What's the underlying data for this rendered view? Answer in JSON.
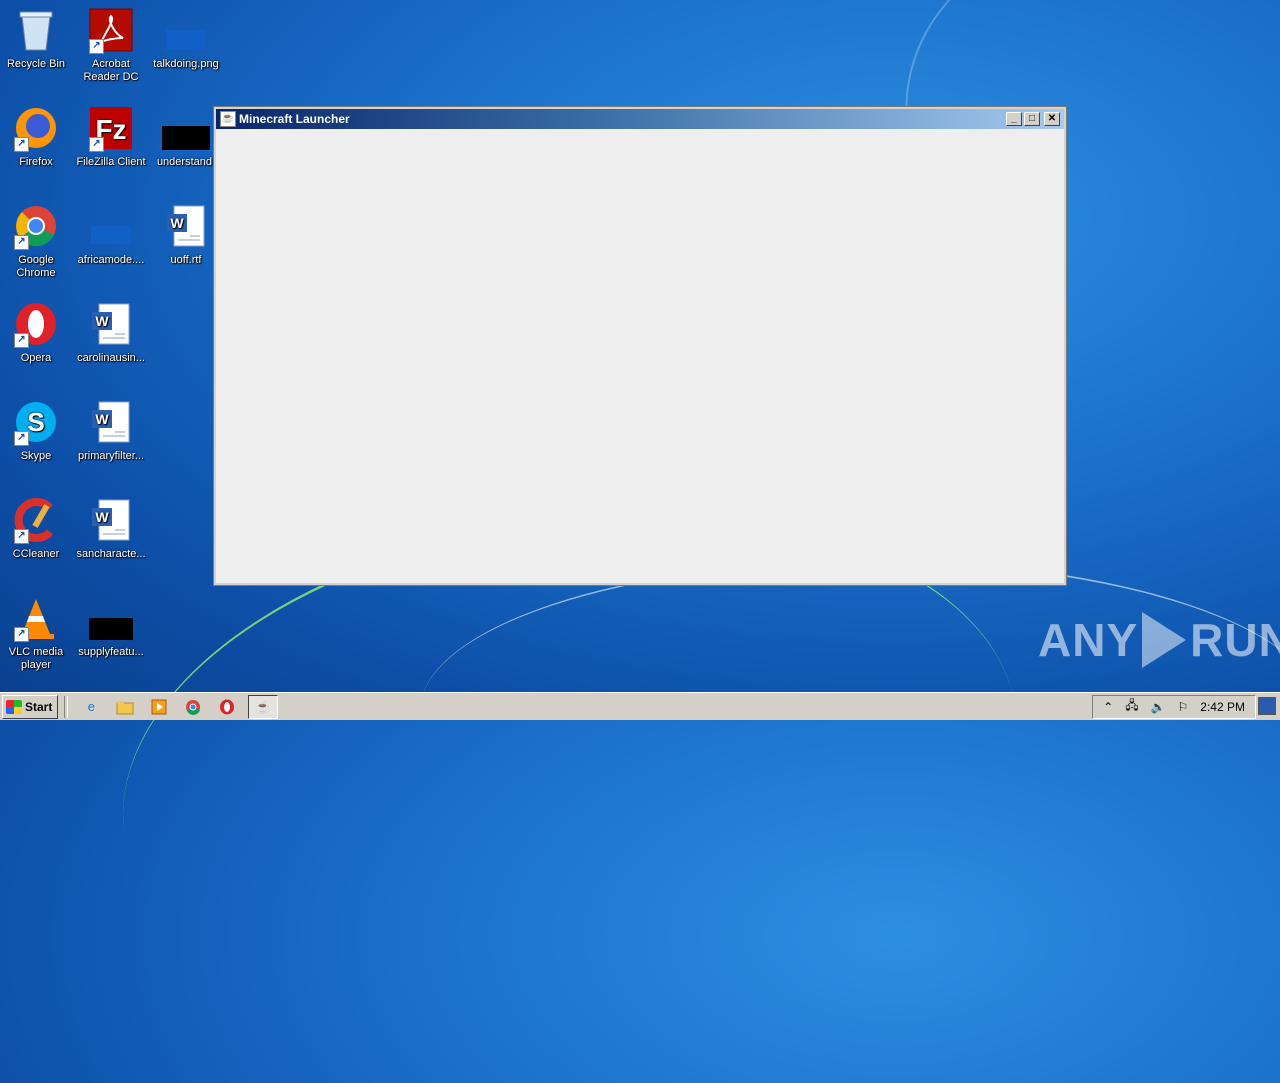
{
  "desktop": {
    "icons": [
      {
        "label": "Recycle Bin",
        "icon": "recycle-bin-icon"
      },
      {
        "label": "Acrobat Reader DC",
        "icon": "acrobat-icon"
      },
      {
        "label": "talkdoing.png",
        "icon": "image-file-icon"
      },
      {
        "label": "Firefox",
        "icon": "firefox-icon"
      },
      {
        "label": "FileZilla Client",
        "icon": "filezilla-icon"
      },
      {
        "label": "understand.",
        "icon": "file-icon"
      },
      {
        "label": "Google Chrome",
        "icon": "chrome-icon"
      },
      {
        "label": "africamode....",
        "icon": "file-icon"
      },
      {
        "label": "uoff.rtf",
        "icon": "word-doc-icon"
      },
      {
        "label": "Opera",
        "icon": "opera-icon"
      },
      {
        "label": "carolinausin...",
        "icon": "word-doc-icon"
      },
      {
        "label": "Skype",
        "icon": "skype-icon"
      },
      {
        "label": "primaryfilter...",
        "icon": "word-doc-icon"
      },
      {
        "label": "CCleaner",
        "icon": "ccleaner-icon"
      },
      {
        "label": "sancharacte...",
        "icon": "word-doc-icon"
      },
      {
        "label": "VLC media player",
        "icon": "vlc-icon"
      },
      {
        "label": "supplyfeatu...",
        "icon": "file-icon"
      }
    ]
  },
  "window": {
    "title": "Minecraft Launcher",
    "minimize": "_",
    "maximize": "□",
    "close": "✕"
  },
  "taskbar": {
    "start_label": "Start",
    "clock": "2:42 PM"
  },
  "watermark": {
    "left": "ANY",
    "right": "RUN"
  }
}
